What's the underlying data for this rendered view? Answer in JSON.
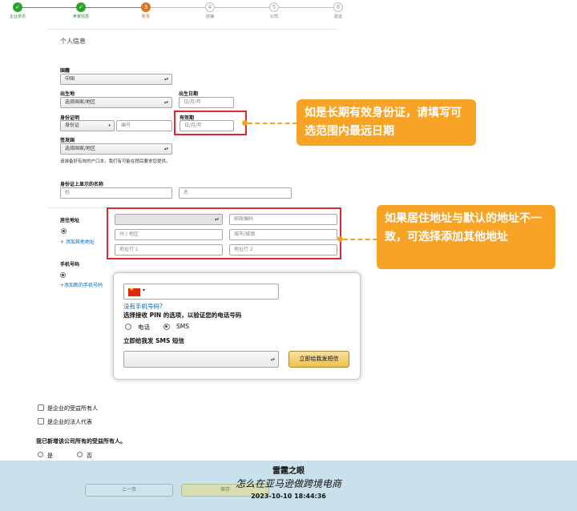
{
  "progress": {
    "steps": [
      {
        "label": "企业资讯",
        "num": "✓"
      },
      {
        "label": "卖家信息",
        "num": "✓"
      },
      {
        "label": "账单",
        "num": "3"
      },
      {
        "label": "店铺",
        "num": "4"
      },
      {
        "label": "公司",
        "num": "5"
      },
      {
        "label": "验证",
        "num": "6"
      }
    ]
  },
  "section_title": "个人信息",
  "nationality": {
    "label": "国籍",
    "value": "中国"
  },
  "birthplace": {
    "label": "出生地",
    "value": "选择国家/地区"
  },
  "birthdate": {
    "label": "出生日期",
    "placeholder": "日/月/年"
  },
  "id_proof": {
    "label": "身份证明",
    "type_value": "身份证",
    "number_placeholder": "编号"
  },
  "expiry": {
    "label": "有效期",
    "placeholder": "日/月/年"
  },
  "issuing_country": {
    "label": "签发国",
    "value": "选择国家/地区"
  },
  "id_note": "请准备好有效的户口本，我们有可能在稍后要求您提供。",
  "id_name": {
    "label": "身份证上显示的名称",
    "last_placeholder": "姓",
    "first_placeholder": "名"
  },
  "address": {
    "label": "居住地址",
    "country_placeholder": "",
    "postal_placeholder": "邮政编码",
    "state_placeholder": "州 / 地区",
    "city_placeholder": "城市/城镇",
    "line1_placeholder": "地址行 1",
    "line2_placeholder": "地址行 2",
    "add_link": "+ 添加其他地址"
  },
  "phone": {
    "label": "手机号码",
    "add_link": "+添加新的手机号码",
    "no_phone_link": "没有手机号码?",
    "pin_prompt": "选择接收 PIN 的选项，以验证您的电话号码",
    "option_call": "电话",
    "option_sms": "SMS",
    "send_title": "立即给我发 SMS 短信",
    "send_button": "立即给我发短信"
  },
  "beneficiary": {
    "check1": "是企业的受益所有人",
    "check2": "是企业的法人代表",
    "question": "我已新增该公司所有的受益所有人。",
    "yes": "是",
    "no": "否"
  },
  "nav": {
    "prev": "上一页",
    "next": "保存"
  },
  "callouts": {
    "expiry_tip": "如是长期有效身份证，请填写可选范围内最远日期",
    "address_tip": "如果居住地址与默认的地址不一致，可选择添加其他地址"
  },
  "footer": {
    "brand": "雷霆之眼",
    "slogan": "怎么在亚马逊做跨境电商",
    "timestamp": "2023-10-10 18:44:36"
  },
  "colors": {
    "accent": "#f7a325",
    "highlight": "#e1262d",
    "done": "#29a329",
    "current": "#e4711b"
  }
}
